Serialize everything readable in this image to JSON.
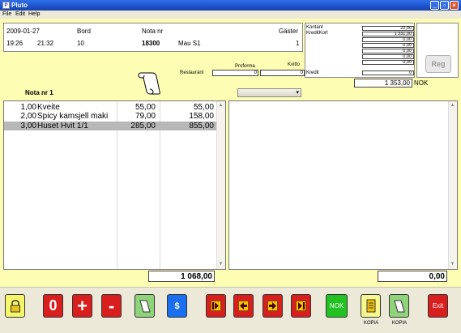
{
  "window": {
    "title": "Pluto",
    "app_icon": "pluto-app-icon",
    "min_glyph": "_",
    "max_glyph": "▫",
    "close_glyph": "×"
  },
  "menu": [
    "File",
    "Edit",
    "Help"
  ],
  "info": {
    "date": "2009-01-27",
    "bord_label": "Bord",
    "nota_nr_label": "Nota nr",
    "gaster_label": "Gäster",
    "time1": "19:26",
    "time2": "21:32",
    "bord_value": "10",
    "nota_nr_value": "18300",
    "waiter": "Mau S1",
    "gaster_value": "1"
  },
  "payments": {
    "kontant_label": "Kontant",
    "kreditkort_label": "KreditKort",
    "kredit_label": "Kredit",
    "values": [
      "22,00",
      "1 331,00",
      "0,00",
      "0,00",
      "0,00",
      "0,00",
      "0,00",
      "0"
    ]
  },
  "reg_button": "Reg",
  "restaurant": {
    "label": "Restaurant",
    "value": "0"
  },
  "proforma": {
    "label": "Proforma",
    "value": "0"
  },
  "kvitto": {
    "label": "Kvitto"
  },
  "total_nok": {
    "value": "1 353,00",
    "currency": "NOK"
  },
  "nota_label": "Nota nr 1",
  "order_items": [
    {
      "qty": "1,00",
      "name": "Kveite",
      "price": "55,00",
      "sum": "55,00"
    },
    {
      "qty": "2,00",
      "name": "Spicy kamsjell maki",
      "price": "79,00",
      "sum": "158,00"
    },
    {
      "qty": "3,00",
      "name": "Huset Hvit 1/1",
      "price": "285,00",
      "sum": "855,00",
      "selected": true
    }
  ],
  "order_total": "1 068,00",
  "split_total": "0,00",
  "toolbar": {
    "zero_label": "0",
    "plus_label": "+",
    "minus_label": "-",
    "dollar_label": "$",
    "nok_label": "NOK",
    "exit_label": "Exit",
    "kopia1_label": "KOPIA",
    "kopia2_label": "KOPIA"
  },
  "colors": {
    "panel_bg": "#fefdb4",
    "red_button": "#d91e1e",
    "green_button": "#22c222",
    "blue_button": "#1a6ef0"
  }
}
